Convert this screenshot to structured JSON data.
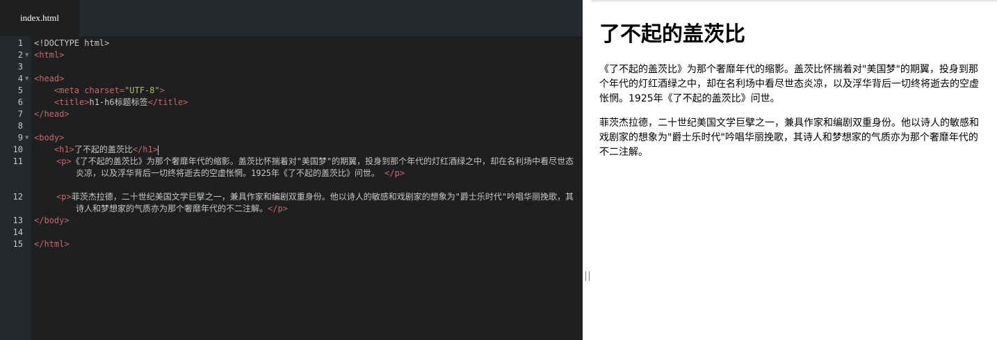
{
  "tab": {
    "filename": "index.html"
  },
  "editor": {
    "line_numbers": [
      "1",
      "2",
      "3",
      "4",
      "5",
      "6",
      "7",
      "8",
      "9",
      "10",
      "11",
      "12",
      "13",
      "14",
      "15"
    ],
    "lines": {
      "l1": "<!DOCTYPE html>",
      "l2_tag": "<html>",
      "l4_tag": "<head>",
      "l5_tag_open": "<meta ",
      "l5_attr": "charset=",
      "l5_str": "\"UTF-8\"",
      "l5_tag_close": ">",
      "l6_open": "<title>",
      "l6_text": "h1-h6标题标签",
      "l6_close": "</title>",
      "l7_tag": "</head>",
      "l9_tag": "<body>",
      "l10_open": "<h1>",
      "l10_text": "了不起的盖茨比",
      "l10_close": "</h1>",
      "l11_open": "<p>",
      "l11_text": "《了不起的盖茨比》为那个奢靡年代的缩影。盖茨比怀揣着对\"美国梦\"的期翼，投身到那个年代的灯红酒绿之中，却在名利场中看尽世态炎凉，以及浮华背后一切终将逝去的空虚怅惘。1925年《了不起的盖茨比》问世。 ",
      "l11_close": "</p>",
      "l12_open": "<p>",
      "l12_text": "菲茨杰拉德，二十世纪美国文学巨擘之一，兼具作家和编剧双重身份。他以诗人的敏感和戏剧家的想象为\"爵士乐时代\"吟唱华丽挽歌，其诗人和梦想家的气质亦为那个奢靡年代的不二注解。",
      "l12_close": "</p>",
      "l13_tag": "</body>",
      "l15_tag": "</html>"
    }
  },
  "preview": {
    "heading": "了不起的盖茨比",
    "paragraph1": "《了不起的盖茨比》为那个奢靡年代的缩影。盖茨比怀揣着对\"美国梦\"的期翼，投身到那个年代的灯红酒绿之中，却在名利场中看尽世态炎凉，以及浮华背后一切终将逝去的空虚怅惘。1925年《了不起的盖茨比》问世。",
    "paragraph2": "菲茨杰拉德，二十世纪美国文学巨擘之一，兼具作家和编剧双重身份。他以诗人的敏感和戏剧家的想象为\"爵士乐时代\"吟唱华丽挽歌，其诗人和梦想家的气质亦为那个奢靡年代的不二注解。"
  },
  "colors": {
    "editor_bg": "#1d1f21",
    "gutter_bg": "#25282c",
    "tag": "#cc6666",
    "string": "#b5bd68",
    "text": "#c5c8c6"
  },
  "icons": {
    "fold_marker": "triangle-down-icon",
    "splitter_grip": "drag-handle-icon"
  }
}
